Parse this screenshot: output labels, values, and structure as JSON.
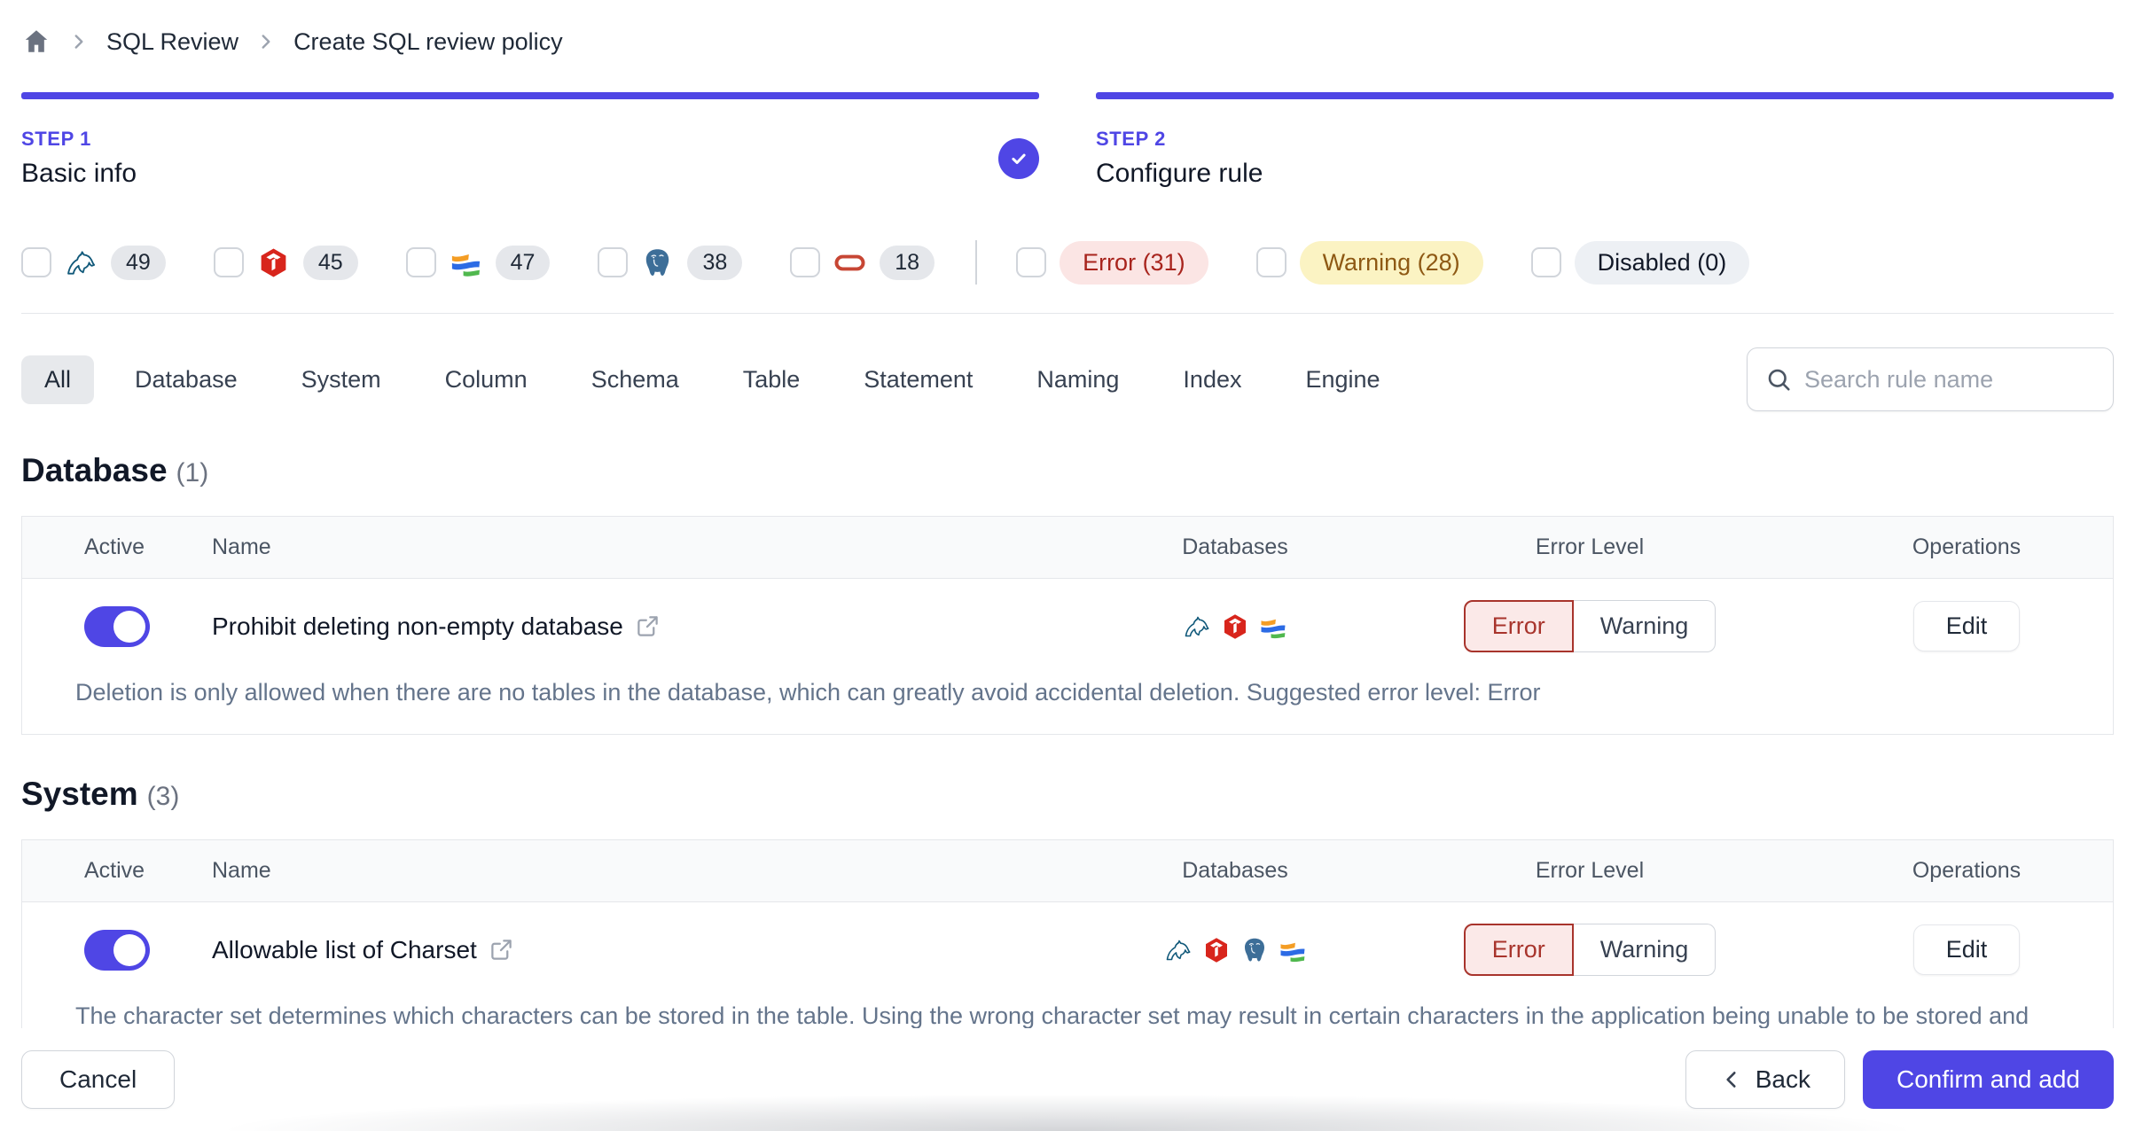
{
  "breadcrumb": {
    "items": [
      "SQL Review",
      "Create SQL review policy"
    ]
  },
  "steps": [
    {
      "label": "STEP 1",
      "title": "Basic info",
      "completed": true
    },
    {
      "label": "STEP 2",
      "title": "Configure rule",
      "completed": false
    }
  ],
  "filters": {
    "engines": [
      {
        "engine": "mysql",
        "count": "49"
      },
      {
        "engine": "tidb",
        "count": "45"
      },
      {
        "engine": "oceanbase",
        "count": "47"
      },
      {
        "engine": "postgres",
        "count": "38"
      },
      {
        "engine": "oracle",
        "count": "18"
      }
    ],
    "levels": [
      {
        "label": "Error (31)",
        "type": "error"
      },
      {
        "label": "Warning (28)",
        "type": "warning"
      },
      {
        "label": "Disabled (0)",
        "type": "disabled"
      }
    ]
  },
  "tabs": {
    "items": [
      "All",
      "Database",
      "System",
      "Column",
      "Schema",
      "Table",
      "Statement",
      "Naming",
      "Index",
      "Engine"
    ],
    "active": "All"
  },
  "search": {
    "placeholder": "Search rule name"
  },
  "table_columns": [
    "Active",
    "Name",
    "Databases",
    "Error Level",
    "Operations"
  ],
  "actions": {
    "error": "Error",
    "warning": "Warning",
    "edit": "Edit"
  },
  "sections": [
    {
      "title": "Database",
      "count": "(1)",
      "rules": [
        {
          "name": "Prohibit deleting non-empty database",
          "engines": [
            "mysql",
            "tidb",
            "oceanbase"
          ],
          "selected_level": "Error",
          "active": true,
          "description": "Deletion is only allowed when there are no tables in the database, which can greatly avoid accidental deletion. Suggested error level: Error"
        }
      ]
    },
    {
      "title": "System",
      "count": "(3)",
      "rules": [
        {
          "name": "Allowable list of Charset",
          "engines": [
            "mysql",
            "tidb",
            "postgres",
            "oceanbase"
          ],
          "selected_level": "Error",
          "active": true,
          "description": "The character set determines which characters can be stored in the table. Using the wrong character set may result in certain characters in the application being unable to be stored and displayed correctly, such as CJK and Emoji. Suggested error level: Error"
        }
      ]
    }
  ],
  "footer": {
    "cancel": "Cancel",
    "back": "Back",
    "confirm": "Confirm and add"
  },
  "colors": {
    "accent": "#4f46e5",
    "error_text": "#a8342c",
    "error_bg": "#fbe9e8",
    "warning_pill_bg": "#fbf3c3",
    "warning_pill_text": "#8e5914",
    "disabled_pill_bg": "#edf0f4"
  }
}
